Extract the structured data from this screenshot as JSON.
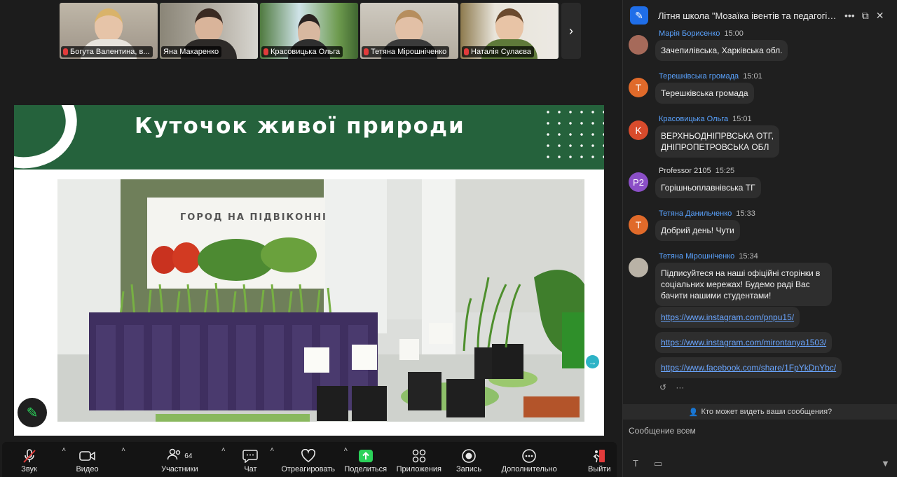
{
  "gallery": {
    "participants": [
      {
        "name": "Богута Валентина, в..."
      },
      {
        "name": "Яна Макаренко"
      },
      {
        "name": "Красовицька Ольга"
      },
      {
        "name": "Тетяна Мірошніченко"
      },
      {
        "name": "Наталія Сулаєва"
      }
    ],
    "next_icon": "chevron-right-icon"
  },
  "slide": {
    "title": "Куточок живої природи",
    "sign_text": "ГОРОД НА ПІДВІКОННІ",
    "header_color": "#25623c"
  },
  "toolbar": {
    "audio": "Звук",
    "video": "Видео",
    "participants": "Участники",
    "participants_count": "64",
    "chat": "Чат",
    "react": "Отреагировать",
    "share": "Поделиться",
    "apps": "Приложения",
    "record": "Запись",
    "more": "Дополнительно",
    "leave": "Выйти"
  },
  "chat": {
    "title": "Літня школа \"Мозаїка івентів та педагогічних...",
    "messages": [
      {
        "sender": "Марія Борисенко",
        "time": "15:00",
        "text": "Зачепилівська, Харківська обл."
      },
      {
        "sender": "Терешківська громада",
        "time": "15:01",
        "avatar": "T",
        "text": "Терешківська громада"
      },
      {
        "sender": "Красовицька Ольга",
        "time": "15:01",
        "avatar": "K",
        "text_line1": "ВЕРХНЬОДНІПРВСЬКА ОТГ,",
        "text_line2": "ДНІПРОПЕТРОВСЬКА ОБЛ"
      },
      {
        "sender": "Professor 2105",
        "time": "15:25",
        "avatar": "P2",
        "text": "Горішньоплавнівська ТГ"
      },
      {
        "sender": "Тетяна Данильченко",
        "time": "15:33",
        "avatar": "T",
        "text": "Добрий день! Чути"
      },
      {
        "sender": "Тетяна Мірошніченко",
        "time": "15:34",
        "text_line1": "Підписуйтеся на наші офіційні сторінки в",
        "text_line2": "соціальних мережах! Будемо раді Вас",
        "text_line3": "бачити нашими студентами!",
        "links": [
          "https://www.instagram.com/pnpu15/",
          "https://www.instagram.com/mirontanya1503/",
          "https://www.facebook.com/share/1FpYkDnYbc/"
        ]
      }
    ],
    "who_can_see": "Кто может видеть ваши сообщения?",
    "compose_placeholder": "Сообщение всем"
  }
}
